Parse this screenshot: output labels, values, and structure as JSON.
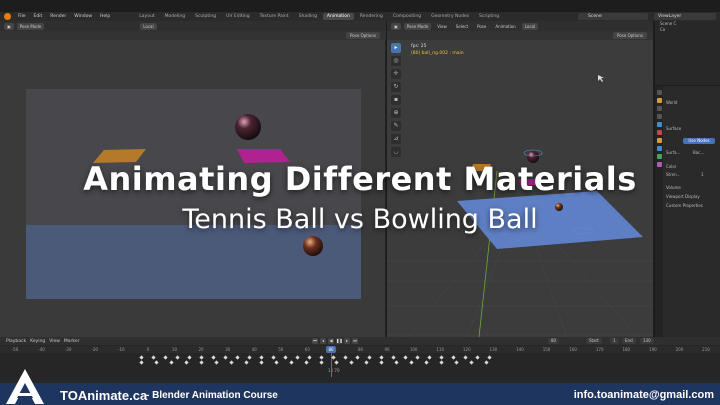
{
  "topbar": {
    "menus": [
      "File",
      "Edit",
      "Render",
      "Window",
      "Help"
    ],
    "workspaces": [
      "Layout",
      "Modeling",
      "Sculpting",
      "UV Editing",
      "Texture Paint",
      "Shading",
      "Animation",
      "Rendering",
      "Compositing",
      "Geometry Nodes",
      "Scripting"
    ],
    "active_workspace": "Animation",
    "scene": "Scene",
    "view_layer": "ViewLayer"
  },
  "left_view": {
    "mode": "Pose Mode",
    "transform": "Local",
    "pose_options": "Pose Options"
  },
  "right_view": {
    "mode": "Pose Mode",
    "menus": [
      "View",
      "Select",
      "Pose",
      "Animation"
    ],
    "transform": "Local",
    "pose_options": "Pose Options",
    "fps": "fps: 25",
    "object_name": "(80) ball_rig.002 : main"
  },
  "outliner": {
    "rows": [
      "Scene C",
      "Co",
      "",
      "",
      "",
      "",
      ""
    ]
  },
  "properties": {
    "world": "World",
    "surface": "Surface",
    "use_nodes": "Use Nodes",
    "surface_field": "Surfa...",
    "surface_value": "Bac...",
    "color": "Color",
    "strength": "Stren...",
    "strength_value": "1",
    "volume": "Volume",
    "viewport_display": "Viewport Display",
    "custom_properties": "Custom Properties"
  },
  "timeline": {
    "menus": [
      "Playback",
      "Keying",
      "View",
      "Marker"
    ],
    "current_frame": "80",
    "current_frame_field": "80",
    "start_label": "Start",
    "start_value": "1",
    "end_label": "End",
    "end_value": "130",
    "ticks": [
      "-50",
      "-40",
      "-30",
      "-20",
      "-10",
      "0",
      "10",
      "20",
      "30",
      "40",
      "50",
      "60",
      "70",
      "80",
      "90",
      "100",
      "110",
      "120",
      "130",
      "140",
      "150",
      "160",
      "170",
      "180",
      "190",
      "200",
      "210"
    ],
    "frame_label": "1 / 70"
  },
  "overlay": {
    "title": "Animating Different Materials",
    "subtitle": "Tennis Ball vs Bowling Ball"
  },
  "footer": {
    "site": "TOAnimate.ca",
    "course": "- Blender Animation Course",
    "email": "info.toanimate@gmail.com"
  },
  "colors": {
    "accent": "#4772b3",
    "footer_bg": "#1e3560",
    "blender_orange": "#e87d0d"
  }
}
